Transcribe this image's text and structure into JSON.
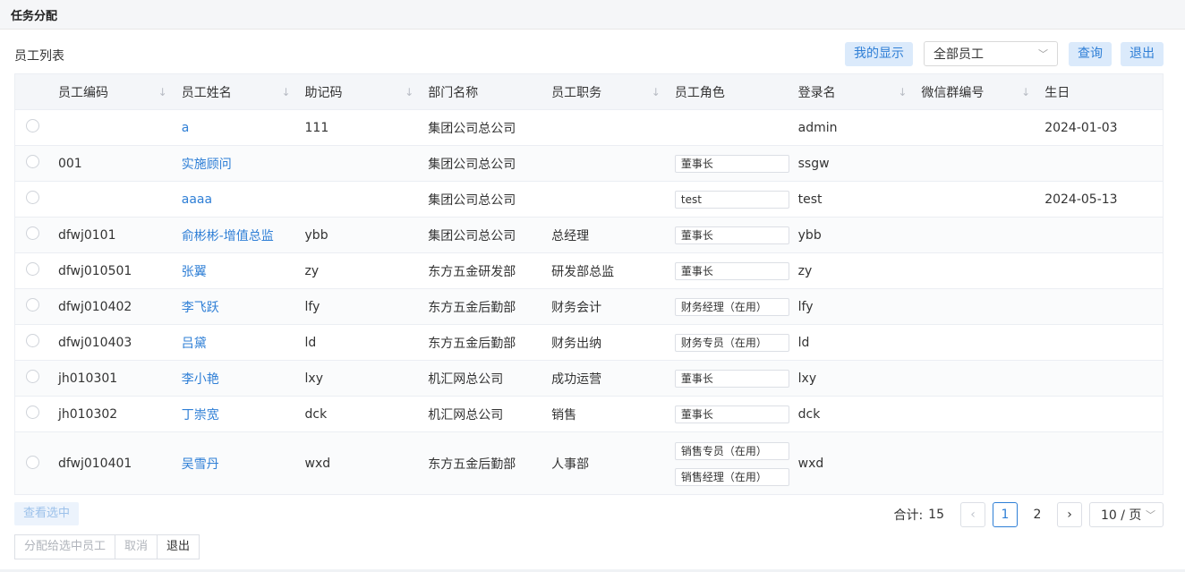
{
  "window": {
    "title": "任务分配"
  },
  "list": {
    "title": "员工列表"
  },
  "toolbar": {
    "my_display": "我的显示",
    "filter_value": "全部员工",
    "query": "查询",
    "exit": "退出"
  },
  "icons": {
    "sort": "sort-arrow-down",
    "chevron": "chevron-down",
    "prev": "chevron-left",
    "next": "chevron-right"
  },
  "table": {
    "columns": [
      "员工编码",
      "员工姓名",
      "助记码",
      "部门名称",
      "员工职务",
      "员工角色",
      "登录名",
      "微信群编号",
      "生日"
    ],
    "rows": [
      {
        "code": "",
        "name": "a",
        "mnemonic": "111",
        "dept": "集团公司总公司",
        "title": "",
        "roles": [],
        "login": "admin",
        "wechat": "",
        "birthday": "2024-01-03"
      },
      {
        "code": "001",
        "name": "实施顾问",
        "mnemonic": "",
        "dept": "集团公司总公司",
        "title": "",
        "roles": [
          "董事长"
        ],
        "login": "ssgw",
        "wechat": "",
        "birthday": ""
      },
      {
        "code": "",
        "name": "aaaa",
        "mnemonic": "",
        "dept": "集团公司总公司",
        "title": "",
        "roles": [
          "test"
        ],
        "login": "test",
        "wechat": "",
        "birthday": "2024-05-13"
      },
      {
        "code": "dfwj0101",
        "name": "俞彬彬-增值总监",
        "mnemonic": "ybb",
        "dept": "集团公司总公司",
        "title": "总经理",
        "roles": [
          "董事长"
        ],
        "login": "ybb",
        "wechat": "",
        "birthday": ""
      },
      {
        "code": "dfwj010501",
        "name": "张翼",
        "mnemonic": "zy",
        "dept": "东方五金研发部",
        "title": "研发部总监",
        "roles": [
          "董事长"
        ],
        "login": "zy",
        "wechat": "",
        "birthday": ""
      },
      {
        "code": "dfwj010402",
        "name": "李飞跃",
        "mnemonic": "lfy",
        "dept": "东方五金后勤部",
        "title": "财务会计",
        "roles": [
          "财务经理（在用）"
        ],
        "login": "lfy",
        "wechat": "",
        "birthday": ""
      },
      {
        "code": "dfwj010403",
        "name": "吕黛",
        "mnemonic": "ld",
        "dept": "东方五金后勤部",
        "title": "财务出纳",
        "roles": [
          "财务专员（在用）"
        ],
        "login": "ld",
        "wechat": "",
        "birthday": ""
      },
      {
        "code": "jh010301",
        "name": "李小艳",
        "mnemonic": "lxy",
        "dept": "机汇网总公司",
        "title": "成功运营",
        "roles": [
          "董事长"
        ],
        "login": "lxy",
        "wechat": "",
        "birthday": ""
      },
      {
        "code": "jh010302",
        "name": "丁崇宽",
        "mnemonic": "dck",
        "dept": "机汇网总公司",
        "title": "销售",
        "roles": [
          "董事长"
        ],
        "login": "dck",
        "wechat": "",
        "birthday": ""
      },
      {
        "code": "dfwj010401",
        "name": "吴雪丹",
        "mnemonic": "wxd",
        "dept": "东方五金后勤部",
        "title": "人事部",
        "roles": [
          "销售专员（在用）",
          "销售经理（在用）"
        ],
        "login": "wxd",
        "wechat": "",
        "birthday": ""
      }
    ]
  },
  "footer": {
    "view_selected": "查看选中",
    "assign": "分配给选中员工",
    "cancel": "取消",
    "exit": "退出"
  },
  "pagination": {
    "total_label": "合计:",
    "total": "15",
    "pages": [
      "1",
      "2"
    ],
    "current": "1",
    "page_size": "10 / 页"
  },
  "colors": {
    "accent": "#2f7fd6",
    "light_button": "#dbeafb",
    "header_bg": "#f4f6f9"
  }
}
